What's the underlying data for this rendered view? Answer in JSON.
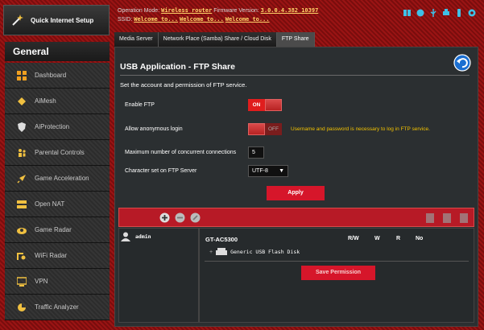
{
  "sidebar": {
    "quick_setup": "Quick Internet Setup",
    "section": "General",
    "items": [
      {
        "label": "Dashboard",
        "icon": "dashboard-icon"
      },
      {
        "label": "AiMesh",
        "icon": "mesh-icon"
      },
      {
        "label": "AiProtection",
        "icon": "shield-icon"
      },
      {
        "label": "Parental Controls",
        "icon": "family-icon"
      },
      {
        "label": "Game Acceleration",
        "icon": "rocket-icon"
      },
      {
        "label": "Open NAT",
        "icon": "nat-icon"
      },
      {
        "label": "Game Radar",
        "icon": "radar-icon"
      },
      {
        "label": "WiFi Radar",
        "icon": "wifi-radar-icon"
      },
      {
        "label": "VPN",
        "icon": "vpn-icon"
      },
      {
        "label": "Traffic Analyzer",
        "icon": "traffic-icon"
      }
    ]
  },
  "header": {
    "op_mode_label": "Operation Mode:",
    "op_mode_value": "Wireless router",
    "fw_label": "Firmware Version:",
    "fw_value": "3.0.0.4.382_10397",
    "ssid_label": "SSID:",
    "ssid_values": [
      "Welcome to...",
      "Welcome to...",
      "Welcome to..."
    ]
  },
  "tabs": [
    "Media Server",
    "Network Place (Samba) Share / Cloud Disk",
    "FTP Share"
  ],
  "active_tab": 2,
  "page": {
    "title": "USB Application - FTP Share",
    "description": "Set the account and permission of FTP service.",
    "enable_ftp_label": "Enable FTP",
    "enable_ftp_state": "ON",
    "anon_label": "Allow anonymous login",
    "anon_state": "OFF",
    "anon_warning": "Username and password is necessary to log in FTP service.",
    "max_conn_label": "Maximum number of concurrent connections",
    "max_conn_value": "5",
    "charset_label": "Character set on FTP Server",
    "charset_value": "UTF-8",
    "apply_label": "Apply"
  },
  "accounts": {
    "users": [
      "admin"
    ],
    "device": "GT-AC5300",
    "columns": [
      "R/W",
      "W",
      "R",
      "No"
    ],
    "folder": "Generic USB Flash Disk",
    "save_label": "Save Permission"
  },
  "colors": {
    "accent": "#d6162a",
    "warning": "#f2c200",
    "panel": "#2b2f31"
  }
}
